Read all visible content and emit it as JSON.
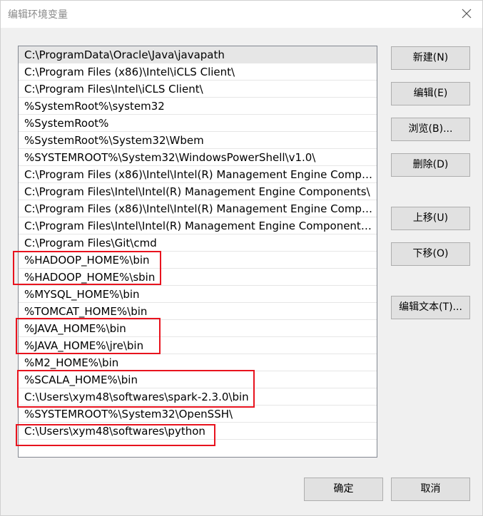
{
  "dialog": {
    "title": "编辑环境变量"
  },
  "paths": [
    "C:\\ProgramData\\Oracle\\Java\\javapath",
    "C:\\Program Files (x86)\\Intel\\iCLS Client\\",
    "C:\\Program Files\\Intel\\iCLS Client\\",
    "%SystemRoot%\\system32",
    "%SystemRoot%",
    "%SystemRoot%\\System32\\Wbem",
    "%SYSTEMROOT%\\System32\\WindowsPowerShell\\v1.0\\",
    "C:\\Program Files (x86)\\Intel\\Intel(R) Management Engine Compon...",
    "C:\\Program Files\\Intel\\Intel(R) Management Engine Components\\",
    "C:\\Program Files (x86)\\Intel\\Intel(R) Management Engine Compon...",
    "C:\\Program Files\\Intel\\Intel(R) Management Engine Components\\I",
    "C:\\Program Files\\Git\\cmd",
    "%HADOOP_HOME%\\bin",
    "%HADOOP_HOME%\\sbin",
    "%MYSQL_HOME%\\bin",
    "%TOMCAT_HOME%\\bin",
    "%JAVA_HOME%\\bin",
    "%JAVA_HOME%\\jre\\bin",
    "%M2_HOME%\\bin",
    "%SCALA_HOME%\\bin",
    "C:\\Users\\xym48\\softwares\\spark-2.3.0\\bin",
    "%SYSTEMROOT%\\System32\\OpenSSH\\",
    "C:\\Users\\xym48\\softwares\\python"
  ],
  "buttons": {
    "new": "新建(N)",
    "edit": "编辑(E)",
    "browse": "浏览(B)...",
    "delete": "删除(D)",
    "move_up": "上移(U)",
    "move_down": "下移(O)",
    "edit_text": "编辑文本(T)...",
    "ok": "确定",
    "cancel": "取消"
  },
  "icons": {
    "close": "close-icon"
  },
  "colors": {
    "highlight_border": "#e8131e",
    "selected_row": "#e6e6e6"
  }
}
